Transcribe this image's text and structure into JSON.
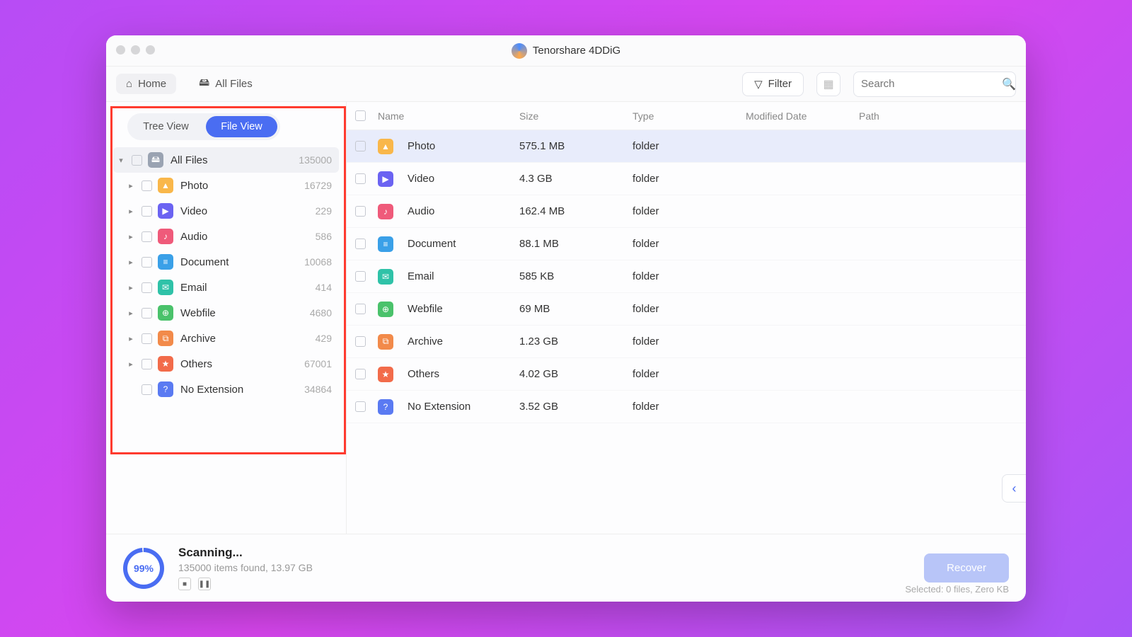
{
  "app_title": "Tenorshare 4DDiG",
  "tabs": {
    "home": "Home",
    "all_files": "All Files"
  },
  "filter_label": "Filter",
  "search_placeholder": "Search",
  "view_toggle": {
    "tree": "Tree View",
    "file": "File View"
  },
  "sidebar": {
    "root": {
      "label": "All Files",
      "count": "135000"
    },
    "items": [
      {
        "label": "Photo",
        "count": "16729",
        "color": "c-photo",
        "glyph": "▲"
      },
      {
        "label": "Video",
        "count": "229",
        "color": "c-video",
        "glyph": "▶"
      },
      {
        "label": "Audio",
        "count": "586",
        "color": "c-audio",
        "glyph": "♪"
      },
      {
        "label": "Document",
        "count": "10068",
        "color": "c-doc",
        "glyph": "≡"
      },
      {
        "label": "Email",
        "count": "414",
        "color": "c-email",
        "glyph": "✉"
      },
      {
        "label": "Webfile",
        "count": "4680",
        "color": "c-web",
        "glyph": "⊕"
      },
      {
        "label": "Archive",
        "count": "429",
        "color": "c-archive",
        "glyph": "⧉"
      },
      {
        "label": "Others",
        "count": "67001",
        "color": "c-others",
        "glyph": "★"
      },
      {
        "label": "No Extension",
        "count": "34864",
        "color": "c-noext",
        "glyph": "?",
        "no_caret": true
      }
    ]
  },
  "columns": {
    "name": "Name",
    "size": "Size",
    "type": "Type",
    "modified": "Modified Date",
    "path": "Path"
  },
  "rows": [
    {
      "name": "Photo",
      "size": "575.1 MB",
      "type": "folder",
      "color": "c-photo",
      "glyph": "▲",
      "selected": true
    },
    {
      "name": "Video",
      "size": "4.3 GB",
      "type": "folder",
      "color": "c-video",
      "glyph": "▶"
    },
    {
      "name": "Audio",
      "size": "162.4 MB",
      "type": "folder",
      "color": "c-audio",
      "glyph": "♪"
    },
    {
      "name": "Document",
      "size": "88.1 MB",
      "type": "folder",
      "color": "c-doc",
      "glyph": "≡"
    },
    {
      "name": "Email",
      "size": "585 KB",
      "type": "folder",
      "color": "c-email",
      "glyph": "✉"
    },
    {
      "name": "Webfile",
      "size": "69 MB",
      "type": "folder",
      "color": "c-web",
      "glyph": "⊕"
    },
    {
      "name": "Archive",
      "size": "1.23 GB",
      "type": "folder",
      "color": "c-archive",
      "glyph": "⧉"
    },
    {
      "name": "Others",
      "size": "4.02 GB",
      "type": "folder",
      "color": "c-others",
      "glyph": "★"
    },
    {
      "name": "No Extension",
      "size": "3.52 GB",
      "type": "folder",
      "color": "c-noext",
      "glyph": "?"
    }
  ],
  "footer": {
    "percent": "99%",
    "title": "Scanning...",
    "subtitle": "135000 items found, 13.97 GB",
    "recover": "Recover",
    "selected": "Selected: 0 files, Zero KB"
  }
}
